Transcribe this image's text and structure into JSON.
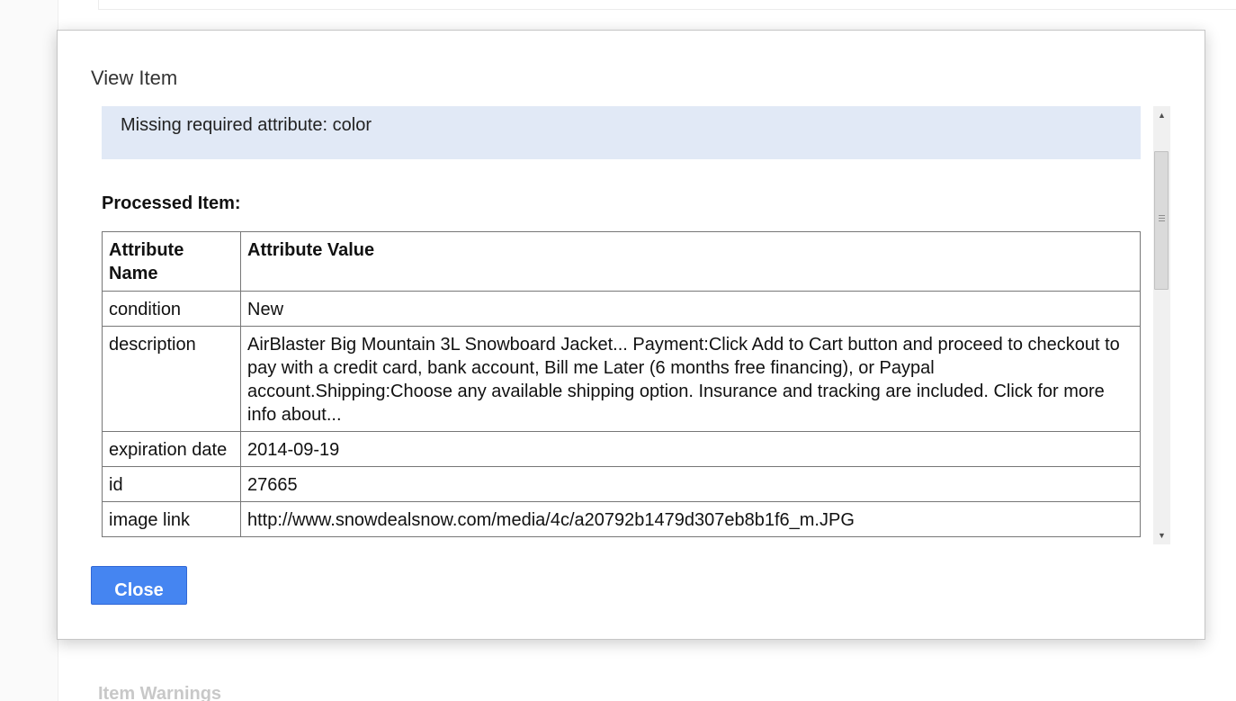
{
  "background": {
    "heading": "Item Warnings"
  },
  "dialog": {
    "title": "View Item",
    "error_message": "Missing required attribute: color",
    "processed_label": "Processed Item:",
    "table": {
      "headers": [
        "Attribute Name",
        "Attribute Value"
      ],
      "rows": [
        {
          "name": "condition",
          "value": "New"
        },
        {
          "name": "description",
          "value": "AirBlaster Big Mountain 3L Snowboard Jacket... Payment:Click Add to Cart button and proceed to checkout to pay with a credit card, bank account, Bill me Later (6 months free financing), or Paypal account.Shipping:Choose any available shipping option. Insurance and tracking are included. Click for more info about..."
        },
        {
          "name": "expiration date",
          "value": "2014-09-19"
        },
        {
          "name": "id",
          "value": "27665"
        },
        {
          "name": "image link",
          "value": "http://www.snowdealsnow.com/media/4c/a20792b1479d307eb8b1f6_m.JPG"
        }
      ]
    },
    "close_label": "Close"
  },
  "colors": {
    "error_background": "#e1e9f6",
    "button_primary": "#4585f1",
    "table_border": "#777777"
  },
  "icons": {
    "scroll_up": "scroll-up-arrow-icon",
    "scroll_down": "scroll-down-arrow-icon",
    "scroll_thumb_grip": "grip-icon"
  }
}
